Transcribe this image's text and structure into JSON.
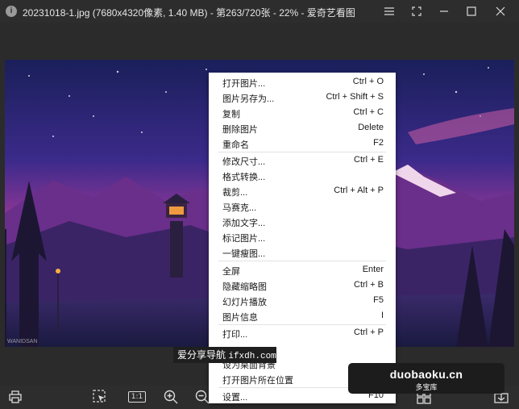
{
  "window": {
    "title": "20231018-1.jpg (7680x4320像素, 1.40 MB) - 第263/720张 - 22% - 爱奇艺看图",
    "app_icon_glyph": "i"
  },
  "photo": {
    "signature_text": "WANIDSAN"
  },
  "context_menu": {
    "items": [
      {
        "label": "打开图片...",
        "shortcut": "Ctrl + O"
      },
      {
        "label": "图片另存为...",
        "shortcut": "Ctrl + Shift + S"
      },
      {
        "label": "复制",
        "shortcut": "Ctrl + C"
      },
      {
        "label": "删除图片",
        "shortcut": "Delete"
      },
      {
        "label": "重命名",
        "shortcut": "F2"
      },
      {
        "label": "修改尺寸...",
        "shortcut": "Ctrl + E"
      },
      {
        "label": "格式转换...",
        "shortcut": ""
      },
      {
        "label": "裁剪...",
        "shortcut": "Ctrl + Alt + P"
      },
      {
        "label": "马赛克...",
        "shortcut": ""
      },
      {
        "label": "添加文字...",
        "shortcut": ""
      },
      {
        "label": "标记图片...",
        "shortcut": ""
      },
      {
        "label": "一键瘦图...",
        "shortcut": ""
      },
      {
        "label": "全屏",
        "shortcut": "Enter"
      },
      {
        "label": "隐藏缩略图",
        "shortcut": "Ctrl + B"
      },
      {
        "label": "幻灯片播放",
        "shortcut": "F5"
      },
      {
        "label": "图片信息",
        "shortcut": "I"
      },
      {
        "label": "打印...",
        "shortcut": "Ctrl + P"
      },
      {
        "label": "",
        "shortcut": ""
      },
      {
        "label": "设为桌面背景",
        "shortcut": ""
      },
      {
        "label": "打开图片所在位置",
        "shortcut": ""
      },
      {
        "label": "设置...",
        "shortcut": "F10"
      }
    ]
  },
  "toolbar": {
    "ratio_label": "1:1"
  },
  "overlay_banner": {
    "text": "爱分享导航",
    "domain": "ifxdh.com"
  },
  "watermark": {
    "main": "duobaoku.cn",
    "sub": "多宝库"
  },
  "colors": {
    "titlebar": "#2d2d2d",
    "background": "#2b2b2b",
    "menu_bg": "#ffffff",
    "watermark_bg": "#1c1c1c"
  }
}
